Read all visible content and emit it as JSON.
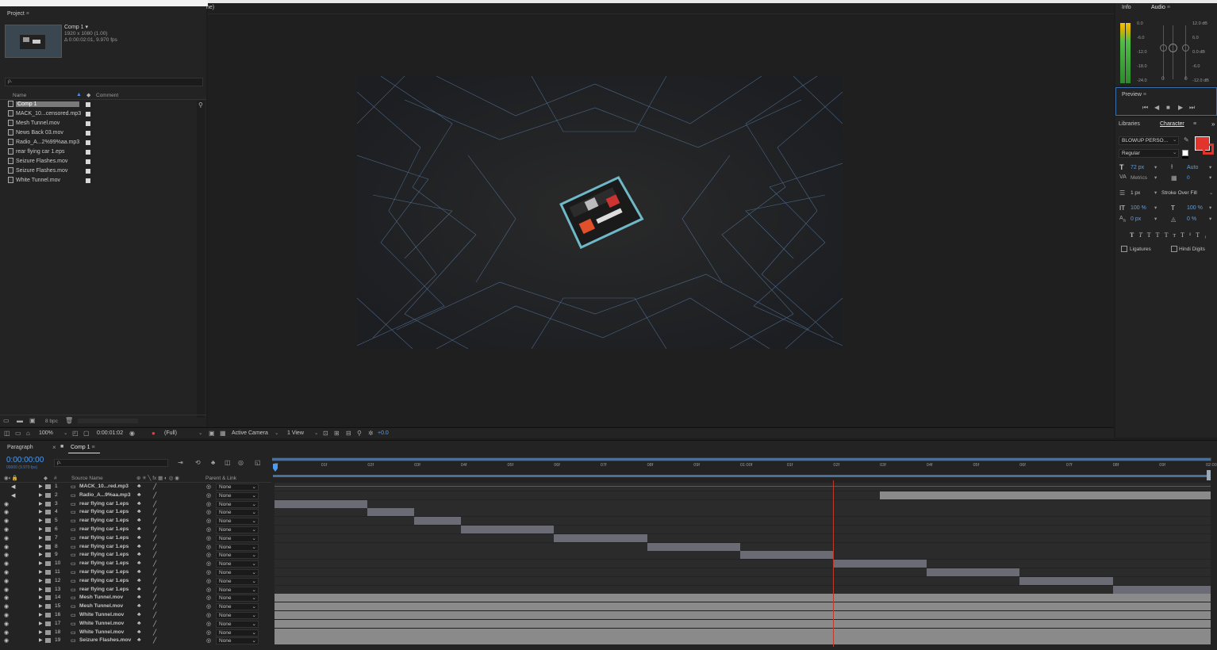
{
  "project": {
    "tab": "Project",
    "comp_name": "Comp 1 ▾",
    "comp_size": "1920 x 1080 (1.00)",
    "comp_duration": "Δ 0:00:02:01, 9.970 fps",
    "search_placeholder": "ρ.",
    "col_name": "Name",
    "col_comment": "Comment",
    "items": [
      {
        "label": "Comp 1",
        "selected": true
      },
      {
        "label": "MACK_10...censored.mp3"
      },
      {
        "label": "Mesh Tunnel.mov"
      },
      {
        "label": "News Back 03.mov"
      },
      {
        "label": "Radio_A...2%99%aa.mp3"
      },
      {
        "label": "rear flying car 1.eps"
      },
      {
        "label": "Seizure Flashes.mov"
      },
      {
        "label": "Seizure Flashes.mov"
      },
      {
        "label": "White Tunnel.mov"
      }
    ],
    "bpc": "8 bpc"
  },
  "viewer": {
    "tab_fragment": "ne)",
    "zoom": "100%",
    "timecode": "0:00:01:02",
    "resolution": "(Full)",
    "camera": "Active Camera",
    "views": "1 View",
    "exposure": "+0.0"
  },
  "info_panel": {
    "tab_info": "Info",
    "tab_audio": "Audio",
    "left_scale": [
      "0.0",
      "-6.0",
      "-12.0",
      "-18.0",
      "-24.0"
    ],
    "right_scale": [
      "12.0 dB",
      "6.0",
      "0.0 dB",
      "-6.0",
      "-12.0 dB"
    ],
    "left_scale2": [
      "0",
      "0"
    ]
  },
  "preview": {
    "tab": "Preview"
  },
  "character": {
    "tab_libraries": "Libraries",
    "tab_character": "Character",
    "font": "BLOWUP PERSO...",
    "style": "Regular",
    "font_size": "72 px",
    "leading": "Auto",
    "kerning": "Metrics",
    "tracking": "0",
    "stroke_width": "1 px",
    "stroke_type": "Stroke Over Fill",
    "vscale": "100 %",
    "hscale": "100 %",
    "baseline": "0 px",
    "tsume": "0 %",
    "ligatures": "Ligatures",
    "hindi": "Hindi Digits",
    "fill_color": "#e0342c"
  },
  "timeline": {
    "tab_paragraph": "Paragraph",
    "tab_comp": "Comp 1",
    "timecode": "0:00:00:00",
    "fps": "00000 (9.970 fps)",
    "col_source": "Source Name",
    "col_parent": "Parent & Link",
    "ruler": [
      "0f",
      "01f",
      "02f",
      "03f",
      "04f",
      "05f",
      "06f",
      "07f",
      "08f",
      "09f",
      "01:00f",
      "01f",
      "02f",
      "03f",
      "04f",
      "05f",
      "06f",
      "07f",
      "08f",
      "09f",
      "02:00"
    ],
    "layers": [
      {
        "n": "1",
        "name": "MACK_10...red.mp3",
        "parent": "None",
        "audio": true
      },
      {
        "n": "2",
        "name": "Radio_A...9%aa.mp3",
        "parent": "None",
        "audio": true
      },
      {
        "n": "3",
        "name": "rear flying car 1.eps",
        "parent": "None"
      },
      {
        "n": "4",
        "name": "rear flying car 1.eps",
        "parent": "None"
      },
      {
        "n": "5",
        "name": "rear flying car 1.eps",
        "parent": "None"
      },
      {
        "n": "6",
        "name": "rear flying car 1.eps",
        "parent": "None"
      },
      {
        "n": "7",
        "name": "rear flying car 1.eps",
        "parent": "None"
      },
      {
        "n": "8",
        "name": "rear flying car 1.eps",
        "parent": "None"
      },
      {
        "n": "9",
        "name": "rear flying car 1.eps",
        "parent": "None"
      },
      {
        "n": "10",
        "name": "rear flying car 1.eps",
        "parent": "None"
      },
      {
        "n": "11",
        "name": "rear flying car 1.eps",
        "parent": "None"
      },
      {
        "n": "12",
        "name": "rear flying car 1.eps",
        "parent": "None"
      },
      {
        "n": "13",
        "name": "rear flying car 1.eps",
        "parent": "None"
      },
      {
        "n": "14",
        "name": "Mesh Tunnel.mov",
        "parent": "None"
      },
      {
        "n": "15",
        "name": "Mesh Tunnel.mov",
        "parent": "None"
      },
      {
        "n": "16",
        "name": "White Tunnel.mov",
        "parent": "None"
      },
      {
        "n": "17",
        "name": "White Tunnel.mov",
        "parent": "None"
      },
      {
        "n": "18",
        "name": "White Tunnel.mov",
        "parent": "None"
      },
      {
        "n": "19",
        "name": "Seizure Flashes.mov",
        "parent": "None"
      }
    ]
  }
}
